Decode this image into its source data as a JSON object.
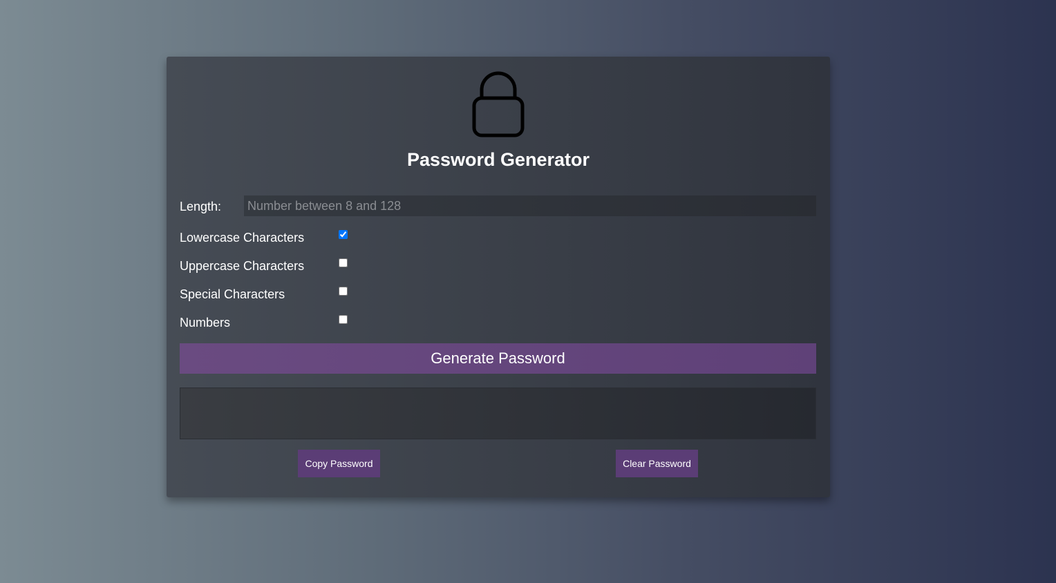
{
  "header": {
    "icon": "lock-icon",
    "title": "Password Generator"
  },
  "length": {
    "label": "Length:",
    "placeholder": "Number between 8 and 128",
    "value": ""
  },
  "options": [
    {
      "label": "Lowercase Characters",
      "checked": true
    },
    {
      "label": "Uppercase Characters",
      "checked": false
    },
    {
      "label": "Special Characters",
      "checked": false
    },
    {
      "label": "Numbers",
      "checked": false
    }
  ],
  "actions": {
    "generate_label": "Generate Password",
    "copy_label": "Copy Password",
    "clear_label": "Clear Password"
  },
  "output": {
    "value": ""
  },
  "colors": {
    "accent": "#5f4178",
    "button_small": "#5b3d76"
  }
}
